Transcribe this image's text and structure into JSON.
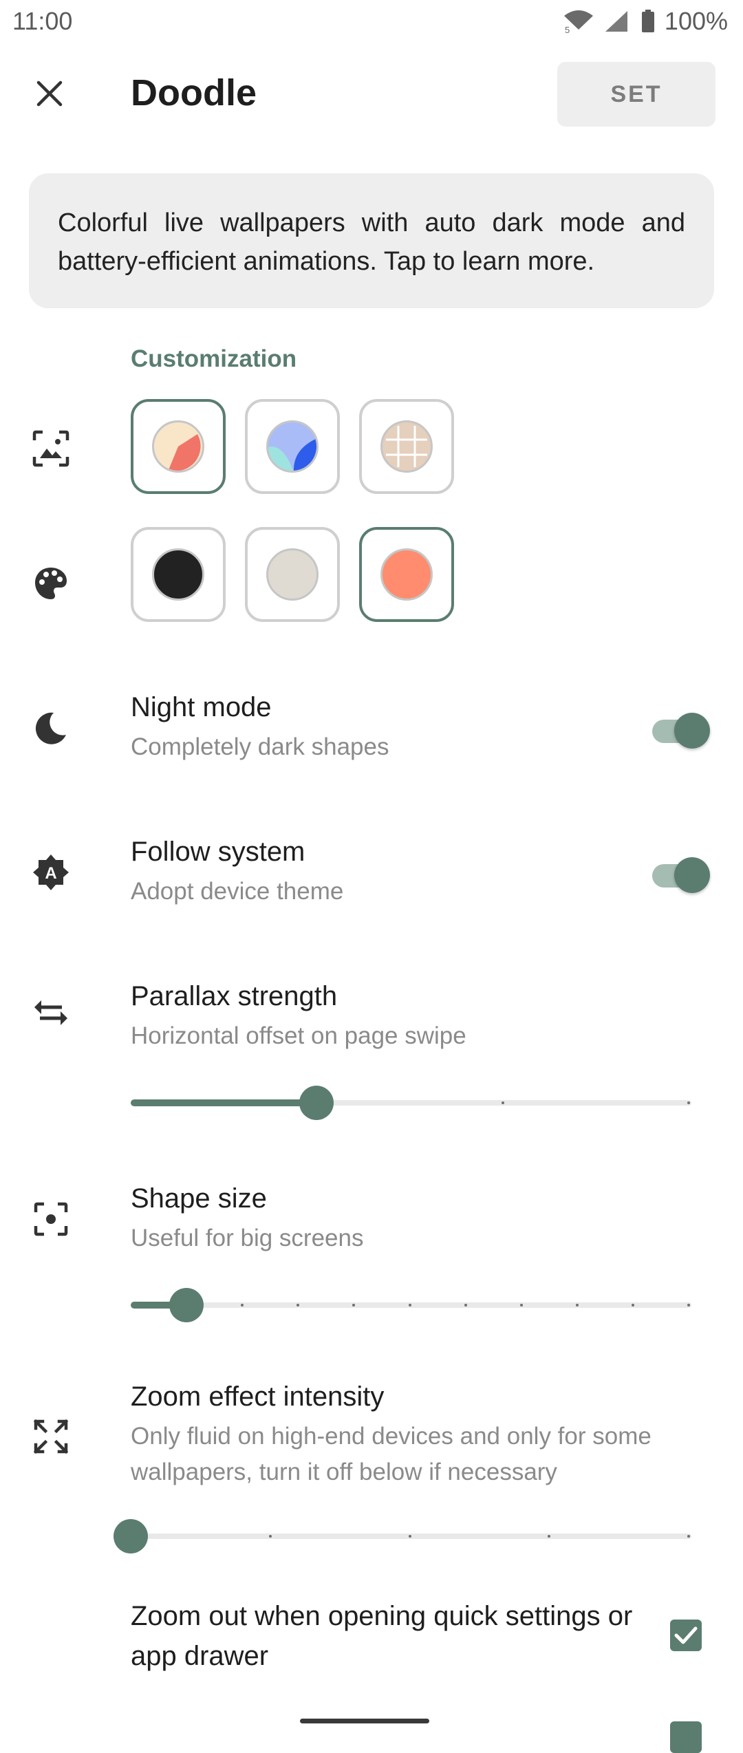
{
  "status_bar": {
    "time": "11:00",
    "wifi_badge": "5",
    "battery": "100%"
  },
  "header": {
    "title": "Doodle",
    "set_label": "SET"
  },
  "info": {
    "text": "Colorful live wallpapers with auto dark mode and battery-efficient animations. Tap to learn more."
  },
  "customization": {
    "label": "Customization",
    "styles": [
      {
        "name": "cream-red",
        "selected": true
      },
      {
        "name": "blue-teal",
        "selected": false
      },
      {
        "name": "beige-grid",
        "selected": false
      }
    ],
    "colors": [
      {
        "hex": "#222222",
        "selected": false
      },
      {
        "hex": "#dfdbd2",
        "selected": false
      },
      {
        "hex": "#ff8c6e",
        "selected": true
      }
    ]
  },
  "night_mode": {
    "title": "Night mode",
    "subtitle": "Completely dark shapes",
    "enabled": true
  },
  "follow_system": {
    "title": "Follow system",
    "subtitle": "Adopt device theme",
    "enabled": true
  },
  "parallax": {
    "title": "Parallax strength",
    "subtitle": "Horizontal offset on page swipe",
    "value": 1,
    "steps": 3
  },
  "shape_size": {
    "title": "Shape size",
    "subtitle": "Useful for big screens",
    "value": 1,
    "steps": 10
  },
  "zoom": {
    "title": "Zoom effect intensity",
    "subtitle": "Only fluid on high-end devices and only for some wallpapers, turn it off below if necessary",
    "value": 0,
    "steps": 4
  },
  "zoom_out_quick": {
    "label": "Zoom out when opening quick settings or app drawer",
    "checked": true
  },
  "colors": {
    "accent": "#5a7d70",
    "accent_light": "#a5bcb3",
    "card": "#eeeeee"
  }
}
